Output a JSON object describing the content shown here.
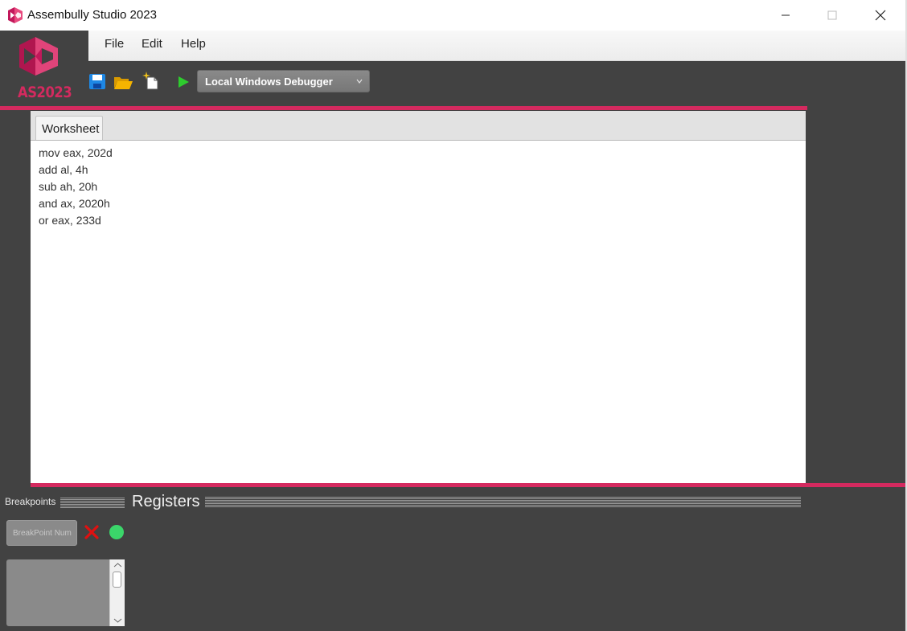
{
  "window": {
    "title": "Assembully Studio 2023",
    "controls": [
      "minimize",
      "maximize",
      "close"
    ]
  },
  "logo": {
    "text": "AS2023"
  },
  "menu": {
    "items": [
      {
        "label": "File"
      },
      {
        "label": "Edit"
      },
      {
        "label": "Help"
      }
    ]
  },
  "toolbar": {
    "icons": [
      "save-icon",
      "open-folder-icon",
      "new-file-icon",
      "run-icon"
    ],
    "debugger_label": "Local Windows Debugger"
  },
  "editor": {
    "tab_label": "Worksheet",
    "lines": [
      "mov eax, 202d",
      "add al, 4h",
      "sub ah, 20h",
      "and ax, 2020h",
      "or eax, 233d"
    ]
  },
  "panels": {
    "breakpoints_label": "Breakpoints",
    "registers_label": "Registers",
    "breakpoint_placeholder": "BreakPoint Num"
  },
  "colors": {
    "accent": "#d42a5f",
    "background": "#424242",
    "run_green": "#2ecc2e",
    "add_green": "#3bd66a",
    "remove_red": "#e01010",
    "save_blue": "#1e88e5",
    "folder_yellow": "#f5b400"
  }
}
